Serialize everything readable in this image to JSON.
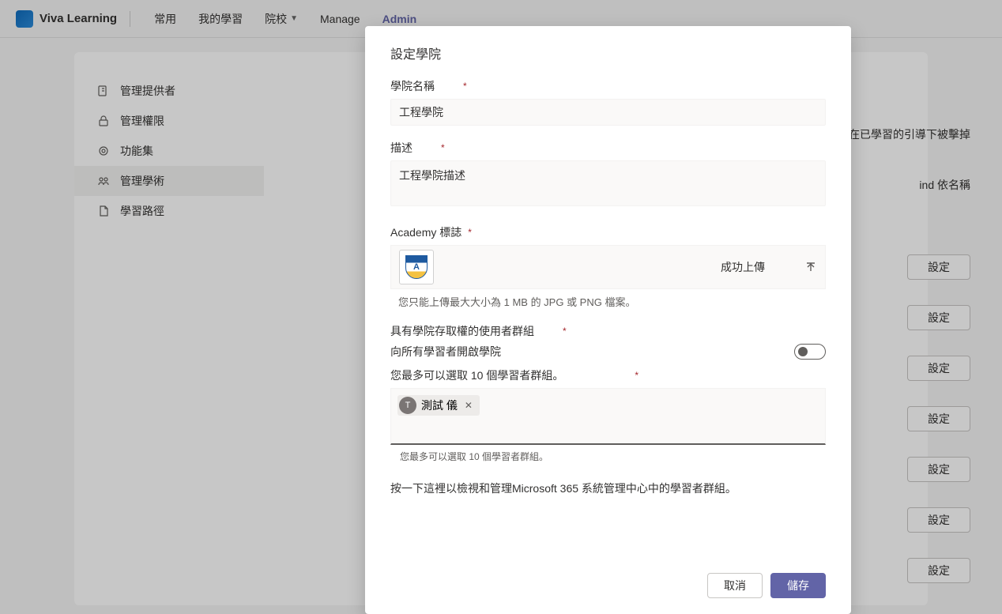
{
  "brand": "Viva Learning",
  "nav": {
    "items": [
      "常用",
      "我的學習",
      "院校",
      "Manage",
      "Admin"
    ]
  },
  "sidebar": {
    "items": [
      {
        "label": "管理提供者"
      },
      {
        "label": "管理權限"
      },
      {
        "label": "功能集"
      },
      {
        "label": "管理學術"
      },
      {
        "label": "學習路徑"
      }
    ]
  },
  "background": {
    "hint1": "s在已學習的引導下被擊掉",
    "hint2": "ind 依名稱",
    "settings_label": "設定"
  },
  "modal": {
    "title": "設定學院",
    "name_label": "學院名稱",
    "name_value": "工程學院",
    "desc_label": "描述",
    "desc_value": "工程學院描述",
    "logo_label": "Academy 標誌",
    "upload_status": "成功上傳",
    "upload_help": "您只能上傳最大大小為 1 MB 的 JPG 或 PNG 檔案。",
    "groups_label": "具有學院存取權的使用者群組",
    "toggle_label": "向所有學習者開啟學院",
    "groups_sub": "您最多可以選取 10 個學習者群組。",
    "chip": {
      "avatar": "T",
      "name": "測試 儀"
    },
    "groups_hint": "您最多可以選取 10 個學習者群組。",
    "admin_link": "按一下這裡以檢視和管理Microsoft 365 系統管理中心中的學習者群組。",
    "cancel": "取消",
    "save": "儲存"
  }
}
